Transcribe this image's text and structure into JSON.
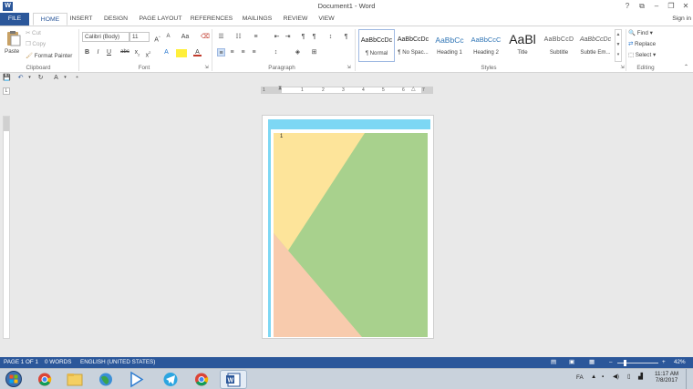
{
  "window": {
    "title": "Document1 - Word",
    "controls": {
      "help": "?",
      "ribbon_options": "⧉",
      "minimize": "–",
      "restore": "❐",
      "close": "✕"
    }
  },
  "tabs": [
    "FILE",
    "HOME",
    "INSERT",
    "DESIGN",
    "PAGE LAYOUT",
    "REFERENCES",
    "MAILINGS",
    "REVIEW",
    "VIEW"
  ],
  "signin": "Sign in",
  "ribbon": {
    "clipboard": {
      "label": "Clipboard",
      "paste": "Paste",
      "cut": "Cut",
      "copy": "Copy",
      "format_painter": "Format Painter"
    },
    "font": {
      "label": "Font",
      "name": "Calibri (Body)",
      "size": "11"
    },
    "paragraph": {
      "label": "Paragraph"
    },
    "styles": {
      "label": "Styles",
      "items": [
        {
          "preview": "AaBbCcDc",
          "name": "¶ Normal"
        },
        {
          "preview": "AaBbCcDc",
          "name": "¶ No Spac..."
        },
        {
          "preview": "AaBbCc",
          "name": "Heading 1"
        },
        {
          "preview": "AaBbCcC",
          "name": "Heading 2"
        },
        {
          "preview": "AaBl",
          "name": "Title"
        },
        {
          "preview": "AaBbCcD",
          "name": "Subtitle"
        },
        {
          "preview": "AaBbCcDc",
          "name": "Subtle Em..."
        }
      ]
    },
    "editing": {
      "label": "Editing",
      "find": "Find",
      "replace": "Replace",
      "select": "Select"
    }
  },
  "ruler": {
    "ticks": [
      "1",
      "1",
      "2",
      "3",
      "4",
      "5",
      "6",
      "7"
    ]
  },
  "document": {
    "page_number": "1",
    "colors": {
      "header_band": "#7dd7f4",
      "yellow": "#fde49a",
      "green": "#a8d18d",
      "peach": "#f8cbad"
    }
  },
  "status": {
    "page": "PAGE 1 OF 1",
    "words": "0 WORDS",
    "language": "ENGLISH (UNITED STATES)",
    "zoom": "42%",
    "zoom_level": 0.42
  },
  "taskbar": {
    "apps": [
      "start",
      "chrome",
      "file-explorer",
      "earth",
      "media-player",
      "telegram",
      "chrome",
      "word"
    ],
    "language": "FA",
    "time": "11:17 AM",
    "date": "7/8/2017"
  },
  "theme": {
    "accent": "#2b579a"
  }
}
